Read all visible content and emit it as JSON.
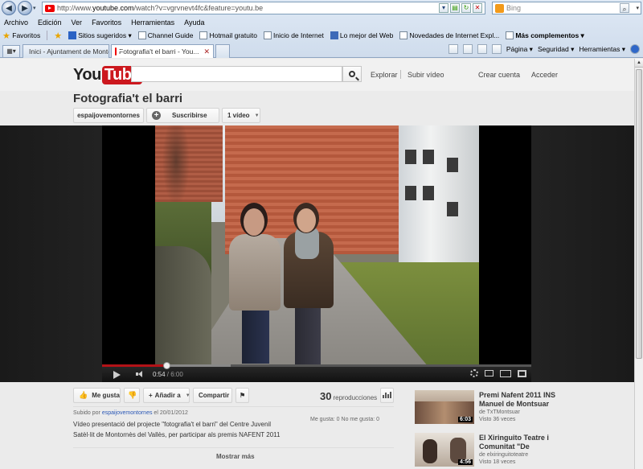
{
  "browser": {
    "url_prefix": "http://www.",
    "url_domain": "youtube.com",
    "url_suffix": "/watch?v=vgrvnevt4fc&feature=youtu.be",
    "search_placeholder": "Bing",
    "menu": [
      "Archivo",
      "Edición",
      "Ver",
      "Favoritos",
      "Herramientas",
      "Ayuda"
    ],
    "favorites_label": "Favoritos",
    "favorites": [
      "Sitios sugeridos ▾",
      "Channel Guide",
      "Hotmail gratuito",
      "Inicio de Internet",
      "Lo mejor del Web",
      "Novedades de Internet Expl...",
      "Más complementos ▾"
    ],
    "tabs": [
      {
        "label": "Inici - Ajuntament de Montor..."
      },
      {
        "label": "Fotografia't el barri - You..."
      }
    ],
    "tools": [
      "Página ▾",
      "Seguridad ▾",
      "Herramientas ▾"
    ]
  },
  "youtube": {
    "logo_you": "You",
    "logo_tube": "Tube",
    "nav": {
      "explore": "Explorar",
      "upload": "Subir vídeo",
      "create_account": "Crear cuenta",
      "login": "Acceder"
    },
    "channel_title": "Fotografia't el barri",
    "channel_name": "espaijovemontornes",
    "subscribe": "Suscribirse",
    "video_count": "1 vídeo",
    "player": {
      "current_time": "0:54",
      "duration": "6:00",
      "progress": 0.15,
      "loaded": 0.3
    },
    "actions": {
      "like": "Me gusta",
      "add_to": "Añadir a",
      "share": "Compartir"
    },
    "views_count": "30",
    "views_label": "reproducciones",
    "uploaded_by_prefix": "Subido por",
    "uploaded_by": "espaijovemontornes",
    "uploaded_date": "el 20/01/2012",
    "likes_text": "Me gusta: 0 No me gusta: 0",
    "description": "Vídeo presentació del projecte \"fotografia't el barri\" del Centre Juvenil Satèl·lit de Montornès del Vallès, per participar als premis NAFENT 2011",
    "show_more": "Mostrar más",
    "related": [
      {
        "title": "Premi Nafent 2011 INS Manuel de Montsuar",
        "by": "de TxTMontsuar",
        "views": "Visto 36 veces",
        "duration": "6:03"
      },
      {
        "title": "El Xiringuito Teatre i Comunitat \"De",
        "by": "de elxiringuitoteatre",
        "views": "Visto 18 veces",
        "duration": "4:56"
      }
    ]
  }
}
